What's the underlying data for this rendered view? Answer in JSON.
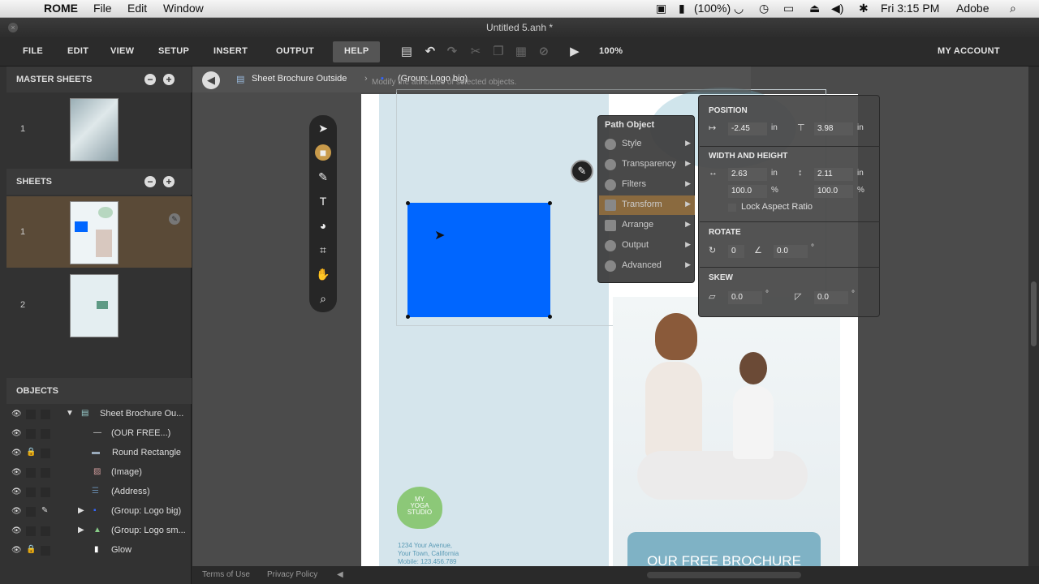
{
  "mac_menubar": {
    "app_name": "ROME",
    "menus": [
      "File",
      "Edit",
      "Window"
    ],
    "battery": "(100%)",
    "clock": "Fri 3:15 PM",
    "user": "Adobe"
  },
  "window": {
    "title": "Untitled 5.anh *"
  },
  "app_menu": {
    "items": [
      "FILE",
      "EDIT",
      "VIEW",
      "SETUP",
      "INSERT",
      "OUTPUT",
      "HELP"
    ],
    "zoom": "100%",
    "account": "MY ACCOUNT"
  },
  "master_sheets": {
    "title": "MASTER SHEETS",
    "items": [
      {
        "num": "1"
      }
    ]
  },
  "sheets": {
    "title": "SHEETS",
    "items": [
      {
        "num": "1"
      },
      {
        "num": "2"
      }
    ]
  },
  "objects": {
    "title": "OBJECTS",
    "items": [
      {
        "label": "Sheet Brochure Ou..."
      },
      {
        "label": "(OUR FREE...)"
      },
      {
        "label": "Round Rectangle"
      },
      {
        "label": "(Image)"
      },
      {
        "label": "(Address)"
      },
      {
        "label": "(Group: Logo big)"
      },
      {
        "label": "(Group: Logo sm..."
      },
      {
        "label": "Glow"
      }
    ]
  },
  "breadcrumb": {
    "sheet": "Sheet Brochure Outside",
    "group": "(Group: Logo big)",
    "tooltip": "Modify the attributes of selected objects."
  },
  "context_menu": {
    "title": "Path Object",
    "items": [
      "Style",
      "Transparency",
      "Filters",
      "Transform",
      "Arrange",
      "Output",
      "Advanced"
    ],
    "selected": "Transform"
  },
  "transform": {
    "position_title": "POSITION",
    "x": "-2.45",
    "y": "3.98",
    "size_title": "WIDTH AND HEIGHT",
    "width": "2.63",
    "height": "2.11",
    "width_pct": "100.0",
    "height_pct": "100.0",
    "unit_in": "in",
    "unit_pct": "%",
    "lock_label": "Lock Aspect Ratio",
    "rotate_title": "ROTATE",
    "rotate_a": "0",
    "rotate_b": "0.0",
    "skew_title": "SKEW",
    "skew_a": "0.0",
    "skew_b": "0.0",
    "deg": "°"
  },
  "brochure": {
    "logo_text_1": "MY",
    "logo_text_2": "YOGA",
    "logo_text_3": "STUDIO",
    "address_1": "1234 Your Avenue,",
    "address_2": "Your Town, California",
    "address_3": "Mobile: 123.456.789",
    "banner": "OUR FREE BROCHURE",
    "watermark_1": "MY",
    "watermark_2": "YOGA",
    "watermark_3": "STUDIO"
  },
  "footer": {
    "terms": "Terms of Use",
    "privacy": "Privacy Policy"
  },
  "colors": {
    "selected_shape": "#0066ff",
    "accent_menu": "#8a6a3f",
    "panel_bg": "#d5e5ec"
  }
}
